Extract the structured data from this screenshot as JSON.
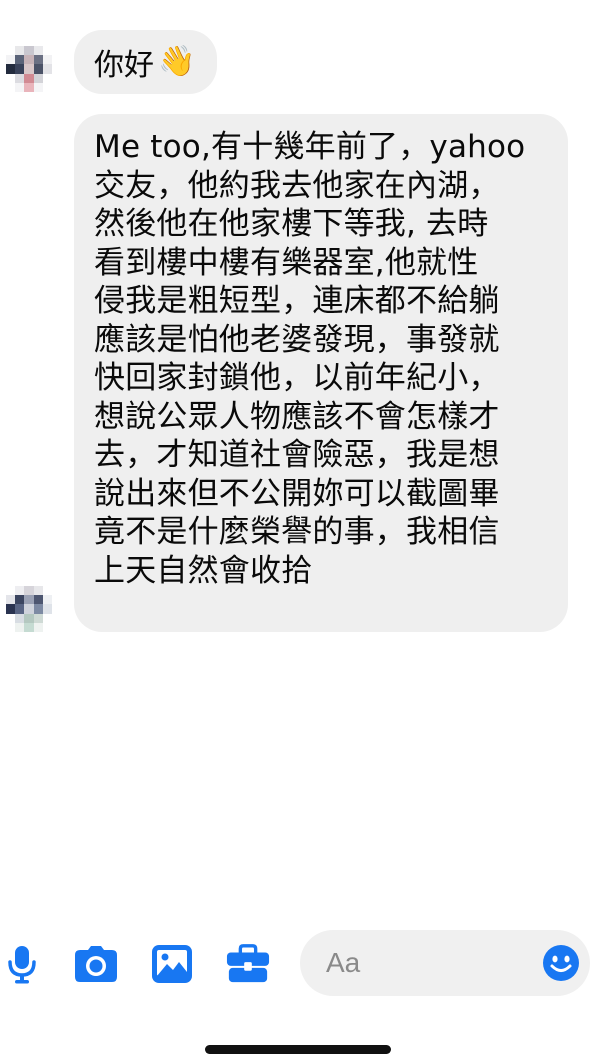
{
  "messages": {
    "greeting": {
      "text": "你好",
      "emoji": "👋"
    },
    "reply": {
      "lines": [
        "Me too,有十幾年前了，yahoo",
        "交友，他約我去他家在內湖，",
        "然後他在他家樓下等我, 去時",
        "看到樓中樓有樂器室,他就性",
        "侵我是粗短型，連床都不給躺",
        "應該是怕他老婆發現，事發就",
        "快回家封鎖他，以前年紀小，",
        "想說公眾人物應該不會怎樣才",
        "去，才知道社會險惡，我是想",
        "說出來但不公開妳可以截圖畢",
        "竟不是什麼榮譽的事，我相信",
        "上天自然會收拾"
      ]
    }
  },
  "composer": {
    "placeholder": "Aa",
    "icons": [
      "microphone-icon",
      "camera-icon",
      "photo-icon",
      "briefcase-icon",
      "smiley-icon"
    ]
  },
  "colors": {
    "accent": "#1877f2",
    "bubble_bg": "#efefef",
    "input_bg": "#f0f0f0"
  }
}
